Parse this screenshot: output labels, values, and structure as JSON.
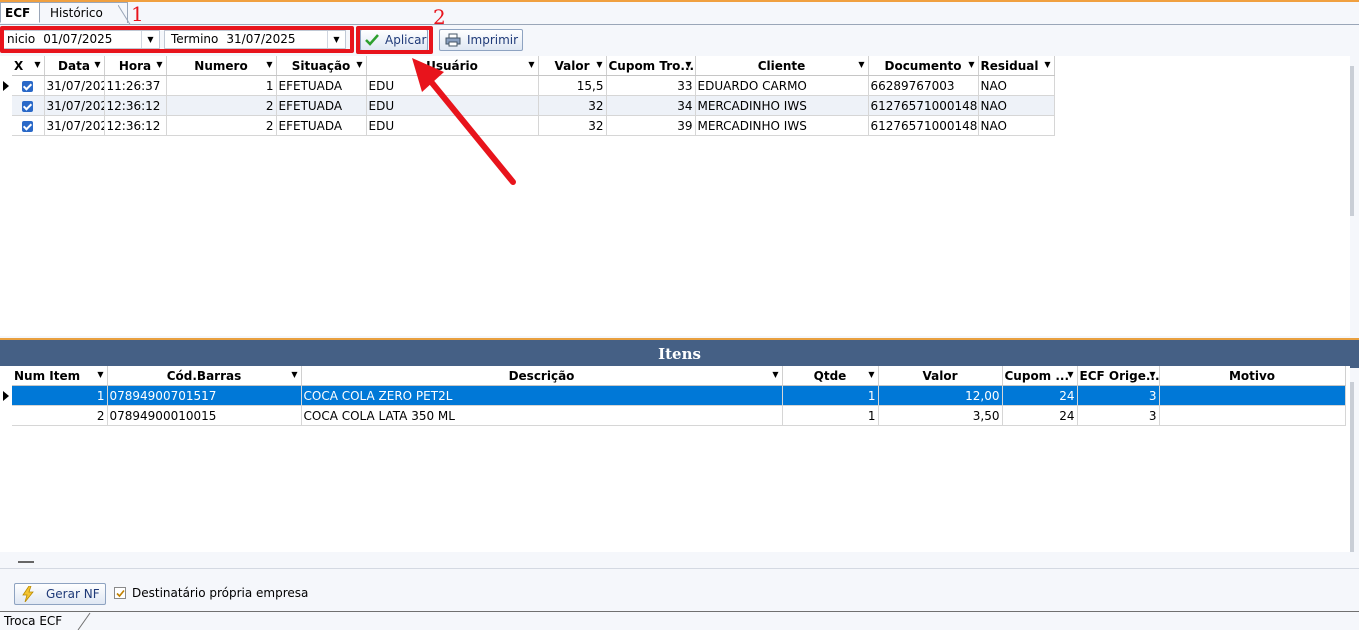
{
  "tabs": [
    "ECF",
    "Histórico"
  ],
  "filter": {
    "inicio_label": "nicio",
    "inicio_value": "01/07/2025",
    "termino_label": "Termino",
    "termino_value": "31/07/2025",
    "apply_label": "Aplicar",
    "print_label": "Imprimir"
  },
  "annotations": [
    "1",
    "2"
  ],
  "colors": {
    "accent": "#e8141c",
    "selection": "#0078d7",
    "header_band": "#456085"
  },
  "ecf_grid": {
    "columns": [
      "X",
      "Data",
      "Hora",
      "Numero",
      "Situação",
      "Usuário",
      "Valor",
      "Cupom Tro...",
      "Cliente",
      "Documento",
      "Residual"
    ],
    "rows": [
      {
        "checked": true,
        "data": "31/07/202",
        "hora": "11:26:37",
        "numero": "1",
        "situacao": "EFETUADA",
        "usuario": "EDU",
        "valor": "15,5",
        "cupom": "33",
        "cliente": "EDUARDO CARMO",
        "documento": "66289767003",
        "residual": "NAO"
      },
      {
        "checked": true,
        "data": "31/07/202",
        "hora": "12:36:12",
        "numero": "2",
        "situacao": "EFETUADA",
        "usuario": "EDU",
        "valor": "32",
        "cupom": "34",
        "cliente": "MERCADINHO IWS",
        "documento": "61276571000148",
        "residual": "NAO"
      },
      {
        "checked": true,
        "data": "31/07/202",
        "hora": "12:36:12",
        "numero": "2",
        "situacao": "EFETUADA",
        "usuario": "EDU",
        "valor": "32",
        "cupom": "39",
        "cliente": "MERCADINHO IWS",
        "documento": "61276571000148",
        "residual": "NAO"
      }
    ]
  },
  "itens": {
    "title": "Itens",
    "columns": [
      "Num Item",
      "Cód.Barras",
      "Descrição",
      "Qtde",
      "Valor",
      "Cupom ...",
      "ECF Orige...",
      "Motivo"
    ],
    "rows": [
      {
        "num": "1",
        "barras": "07894900701517",
        "descricao": "COCA COLA ZERO PET2L",
        "qtde": "1",
        "valor": "12,00",
        "cupom": "24",
        "ecf": "3",
        "motivo": ""
      },
      {
        "num": "2",
        "barras": "07894900010015",
        "descricao": "COCA COLA LATA 350 ML",
        "qtde": "1",
        "valor": "3,50",
        "cupom": "24",
        "ecf": "3",
        "motivo": ""
      }
    ]
  },
  "footer": {
    "gerar_label": "Gerar NF",
    "destinatario_label": "Destinatário própria empresa",
    "destinatario_checked": true,
    "status_tab": "Troca ECF"
  }
}
